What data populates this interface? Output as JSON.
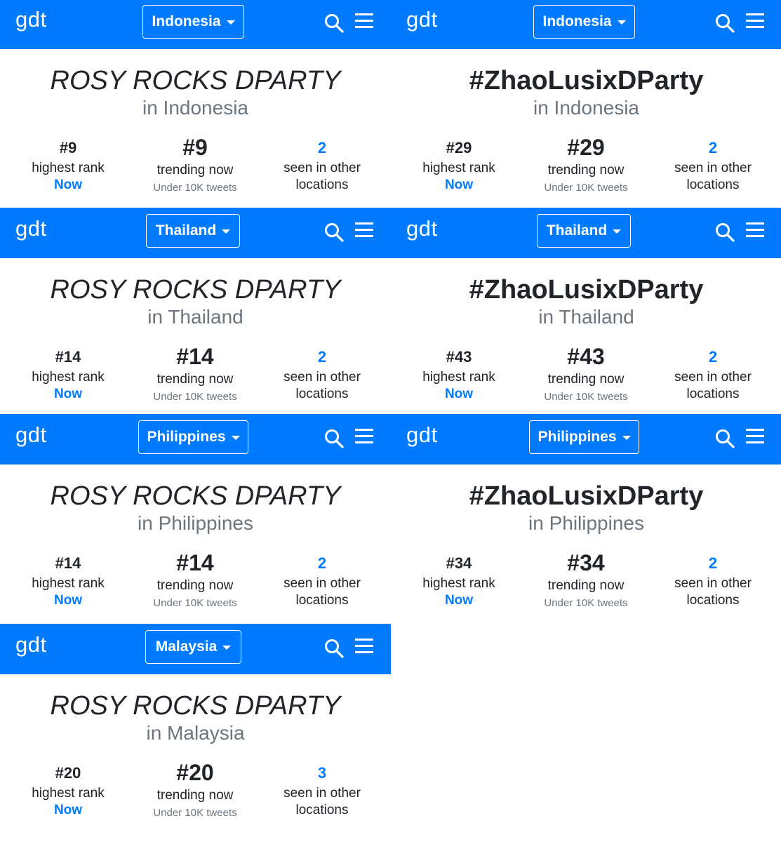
{
  "brand": {
    "logo": "gdt",
    "accent": "#007bff"
  },
  "labels": {
    "highest_rank": "highest rank",
    "now_link": "Now",
    "trending_now": "trending now",
    "tweets": "Under 10K tweets",
    "seen_in_other": "seen in other",
    "locations": "locations"
  },
  "panels": [
    {
      "country": "Indonesia",
      "trend": "ROSY ROCKS DPARTY",
      "location": "in Indonesia",
      "highest_rank": "#9",
      "trending_now": "#9",
      "other_locations": "2"
    },
    {
      "country": "Indonesia",
      "trend": "#ZhaoLusixDParty",
      "location": "in Indonesia",
      "highest_rank": "#29",
      "trending_now": "#29",
      "other_locations": "2"
    },
    {
      "country": "Thailand",
      "trend": "ROSY ROCKS DPARTY",
      "location": "in Thailand",
      "highest_rank": "#14",
      "trending_now": "#14",
      "other_locations": "2"
    },
    {
      "country": "Thailand",
      "trend": "#ZhaoLusixDParty",
      "location": "in Thailand",
      "highest_rank": "#43",
      "trending_now": "#43",
      "other_locations": "2"
    },
    {
      "country": "Philippines",
      "trend": "ROSY ROCKS DPARTY",
      "location": "in Philippines",
      "highest_rank": "#14",
      "trending_now": "#14",
      "other_locations": "2"
    },
    {
      "country": "Philippines",
      "trend": "#ZhaoLusixDParty",
      "location": "in Philippines",
      "highest_rank": "#34",
      "trending_now": "#34",
      "other_locations": "2"
    },
    {
      "country": "Malaysia",
      "trend": "ROSY ROCKS DPARTY",
      "location": "in Malaysia",
      "highest_rank": "#20",
      "trending_now": "#20",
      "other_locations": "3"
    }
  ]
}
